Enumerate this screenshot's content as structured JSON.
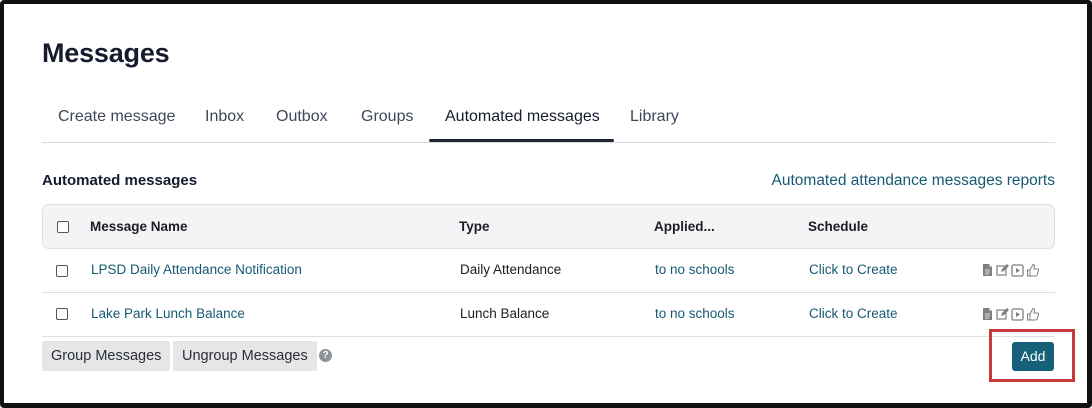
{
  "page": {
    "title": "Messages"
  },
  "tabs": [
    {
      "label": "Create message"
    },
    {
      "label": "Inbox"
    },
    {
      "label": "Outbox"
    },
    {
      "label": "Groups"
    },
    {
      "label": "Automated messages",
      "active": true
    },
    {
      "label": "Library"
    }
  ],
  "section": {
    "title": "Automated messages",
    "report_link": "Automated attendance messages reports"
  },
  "table": {
    "headers": {
      "name": "Message Name",
      "type": "Type",
      "applied": "Applied...",
      "schedule": "Schedule"
    },
    "rows": [
      {
        "name": "LPSD Daily Attendance Notification",
        "type": "Daily Attendance",
        "applied": "to no schools",
        "schedule": "Click to Create",
        "checked": false
      },
      {
        "name": "Lake Park Lunch Balance",
        "type": "Lunch Balance",
        "applied": "to no schools",
        "schedule": "Click to Create",
        "checked": false
      }
    ],
    "row_actions": [
      "document-icon",
      "edit-icon",
      "play-icon",
      "thumbs-up-icon"
    ]
  },
  "footer": {
    "group_label": "Group Messages",
    "ungroup_label": "Ungroup Messages",
    "help_glyph": "?",
    "add_label": "Add"
  },
  "colors": {
    "link": "#155a73",
    "primary_button": "#16607a",
    "highlight_box": "#c73a3a"
  }
}
